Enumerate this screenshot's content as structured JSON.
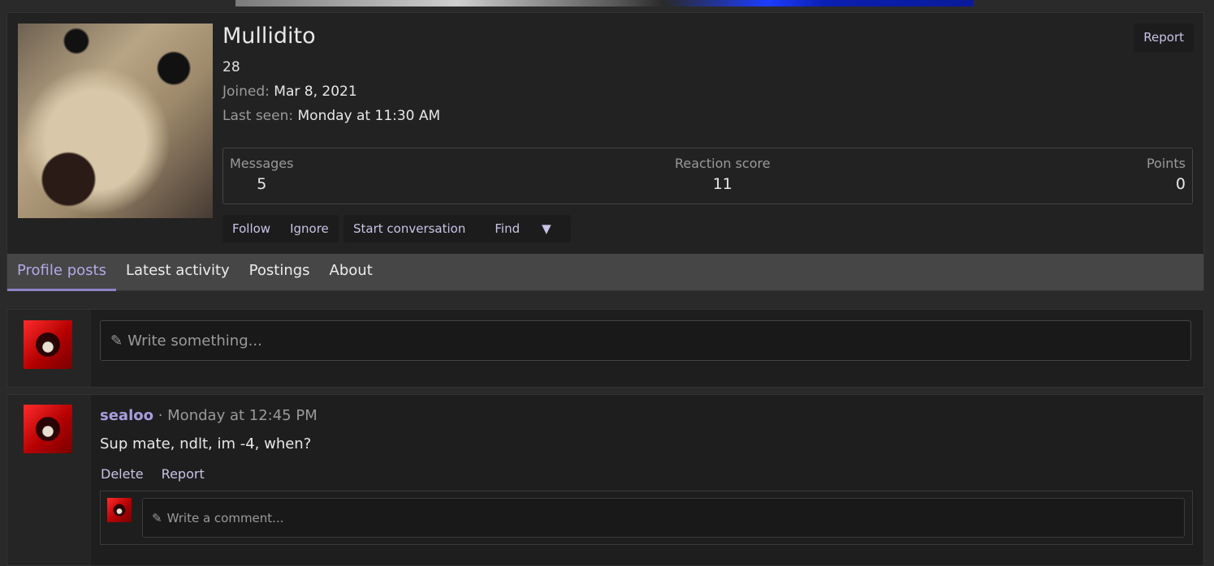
{
  "profile": {
    "username": "Mullidito",
    "custom_title": "28",
    "joined_label": "Joined:",
    "joined_value": "Mar 8, 2021",
    "last_seen_label": "Last seen:",
    "last_seen_value": "Monday at 11:30 AM",
    "report_label": "Report",
    "stats": [
      {
        "label": "Messages",
        "value": "5"
      },
      {
        "label": "Reaction score",
        "value": "11"
      },
      {
        "label": "Points",
        "value": "0"
      }
    ],
    "actions": {
      "follow": "Follow",
      "ignore": "Ignore",
      "start_conversation": "Start conversation",
      "find": "Find"
    }
  },
  "tabs": [
    {
      "label": "Profile posts",
      "active": true
    },
    {
      "label": "Latest activity",
      "active": false
    },
    {
      "label": "Postings",
      "active": false
    },
    {
      "label": "About",
      "active": false
    }
  ],
  "composer": {
    "placeholder": "Write something..."
  },
  "post": {
    "author": "sealoo",
    "separator": " · ",
    "time": "Monday at 12:45 PM",
    "body": "Sup mate, ndlt, im -4, when?",
    "delete_label": "Delete",
    "report_label": "Report",
    "comment_placeholder": "Write a comment..."
  },
  "colors": {
    "accent": "#a99de0",
    "tab_active_underline": "#8f81c8",
    "background": "#2a2a2a"
  }
}
